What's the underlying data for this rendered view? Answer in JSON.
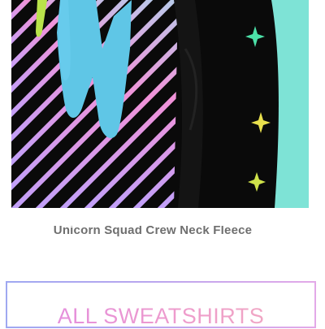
{
  "product": {
    "title": "Unicorn Squad Crew Neck Fleece",
    "image_alt": "Black sweatshirt with neon striped pattern and teal graphic",
    "colors": {
      "background": "#7ee3d6",
      "garment": "#0a0a0a",
      "letter": "#5fc6e6",
      "stripes": [
        "#c89cf0",
        "#f08fd2",
        "#9fe0f0"
      ],
      "sparkle": "#e5e04a"
    }
  },
  "cta": {
    "label": "ALL SWEATSHIRTS",
    "border_gradient": [
      "#9fa8f1",
      "#e3a9e8"
    ],
    "text_gradient": [
      "#e58fdc",
      "#f0a6c4"
    ]
  }
}
